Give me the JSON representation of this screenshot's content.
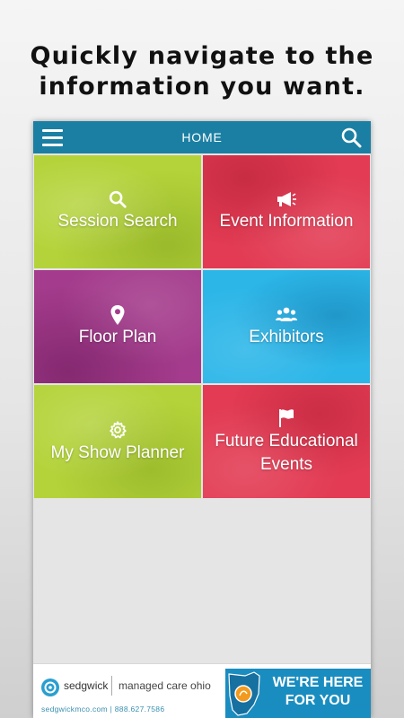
{
  "promo": {
    "line1": "Quickly navigate to the",
    "line2": "information you want."
  },
  "header": {
    "title": "HOME",
    "menu_icon": "hamburger-menu-icon",
    "search_icon": "search-icon",
    "bar_color": "#1b7fa3"
  },
  "tiles": [
    {
      "label": "Session Search",
      "icon": "search-icon",
      "color": "#b4d33a"
    },
    {
      "label": "Event Information",
      "icon": "megaphone-icon",
      "color": "#e23b53"
    },
    {
      "label": "Floor Plan",
      "icon": "map-pin-icon",
      "color": "#a43b8c"
    },
    {
      "label": "Exhibitors",
      "icon": "group-icon",
      "color": "#2cb6e8"
    },
    {
      "label": "My Show Planner",
      "icon": "gear-icon",
      "color": "#b4d33a"
    },
    {
      "label_line1": "Future Educational",
      "label_line2": "Events",
      "icon": "flag-icon",
      "color": "#e23b53"
    }
  ],
  "ad": {
    "brand": "sedgwick",
    "tagline": "managed care ohio",
    "contact": "sedgwickmco.com | 888.627.7586",
    "cta_line1": "WE'RE HERE",
    "cta_line2": "FOR YOU",
    "accent": "#1a8dc0"
  }
}
